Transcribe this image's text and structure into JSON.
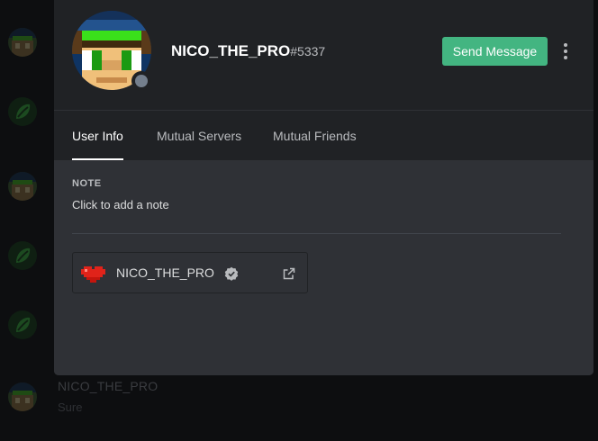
{
  "background_chat": {
    "author": "NICO_THE_PRO",
    "message": "Sure"
  },
  "profile": {
    "username": "NICO_THE_PRO",
    "discriminator": "#5337",
    "status": "offline",
    "send_message_label": "Send Message",
    "more_icon": "vertical-ellipsis-icon"
  },
  "tabs": [
    {
      "label": "User Info",
      "active": true
    },
    {
      "label": "Mutual Servers",
      "active": false
    },
    {
      "label": "Mutual Friends",
      "active": false
    }
  ],
  "user_info": {
    "note_title": "NOTE",
    "note_placeholder": "Click to add a note"
  },
  "connected_accounts": [
    {
      "service_icon": "pixel-heart-icon",
      "name": "NICO_THE_PRO",
      "verified": true,
      "verified_icon": "verified-badge-icon",
      "link_icon": "external-link-icon"
    }
  ],
  "colors": {
    "accent_green": "#43b581",
    "modal_bg": "#2f3136",
    "header_bg": "#202225",
    "status_offline": "#747f8d",
    "heart_red": "#e0231a"
  }
}
